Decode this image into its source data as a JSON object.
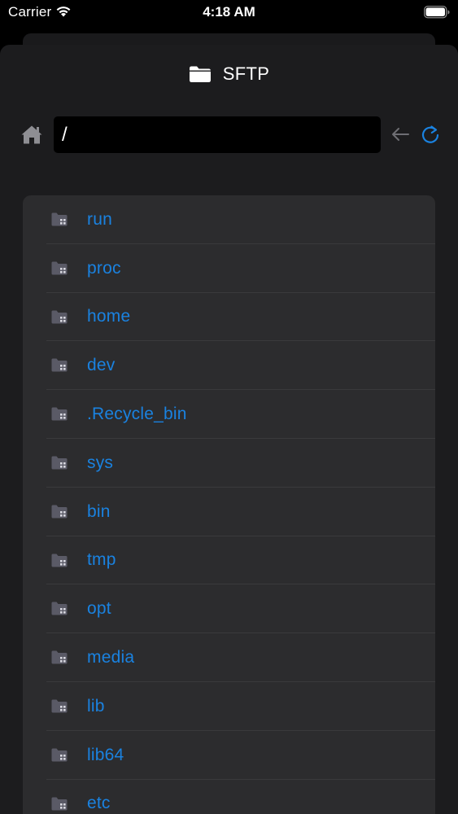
{
  "status_bar": {
    "carrier": "Carrier",
    "time": "4:18 AM"
  },
  "header": {
    "title": "SFTP",
    "icon": "folder-icon"
  },
  "path_bar": {
    "value": "/",
    "home_icon": "home-icon",
    "back_icon": "back-arrow-icon",
    "refresh_icon": "refresh-icon"
  },
  "colors": {
    "link": "#1a82e0",
    "background": "#1c1c1e",
    "row_background": "#2c2c2e",
    "icon_gray": "#8e8e93"
  },
  "entries": [
    {
      "name": "run"
    },
    {
      "name": "proc"
    },
    {
      "name": "home"
    },
    {
      "name": "dev"
    },
    {
      "name": ".Recycle_bin"
    },
    {
      "name": "sys"
    },
    {
      "name": "bin"
    },
    {
      "name": "tmp"
    },
    {
      "name": "opt"
    },
    {
      "name": "media"
    },
    {
      "name": "lib"
    },
    {
      "name": "lib64"
    },
    {
      "name": "etc"
    }
  ]
}
